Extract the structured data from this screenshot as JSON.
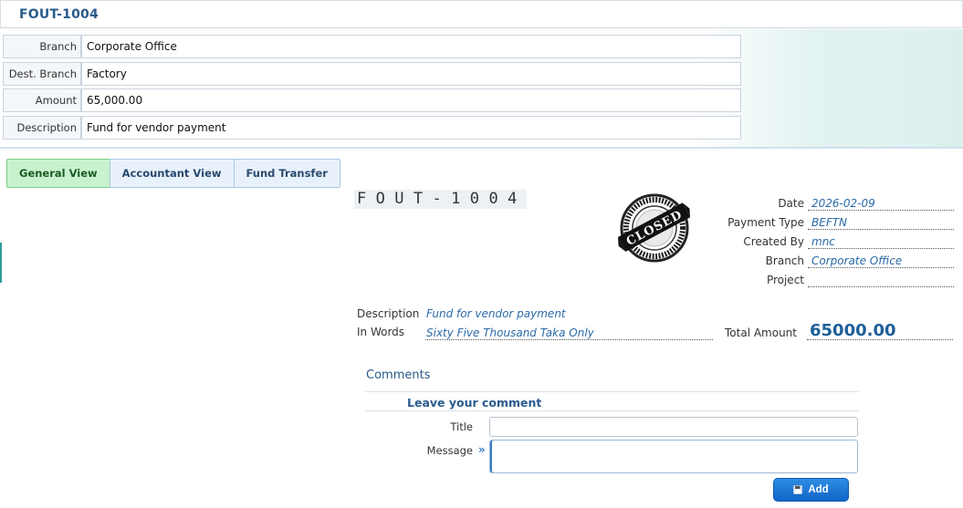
{
  "header": {
    "title": "FOUT-1004"
  },
  "form": {
    "rows": [
      {
        "label": "Branch",
        "value": "Corporate Office"
      },
      {
        "label": "Dest. Branch",
        "value": "Factory"
      },
      {
        "label": "Amount",
        "value": "65,000.00"
      },
      {
        "label": "Description",
        "value": "Fund for vendor payment"
      }
    ]
  },
  "tabs": [
    {
      "label": "General View",
      "active": true
    },
    {
      "label": "Accountant View",
      "active": false
    },
    {
      "label": "Fund Transfer",
      "active": false
    }
  ],
  "voucher": {
    "id": "FOUT-1004",
    "stamp": {
      "text": "CLOSED",
      "icon": "closed-stamp-icon"
    },
    "meta": [
      {
        "label": "Date",
        "value": "2026-02-09"
      },
      {
        "label": "Payment Type",
        "value": "BEFTN"
      },
      {
        "label": "Created By",
        "value": "mnc"
      },
      {
        "label": "Branch",
        "value": "Corporate Office"
      },
      {
        "label": "Project",
        "value": ""
      }
    ],
    "description_label": "Description",
    "description": "Fund for vendor payment",
    "in_words_label": "In Words",
    "in_words": "Sixty Five Thousand Taka Only",
    "total_label": "Total Amount",
    "total": "65000.00"
  },
  "comments": {
    "section_title": "Comments",
    "form_title": "Leave your comment",
    "title_label": "Title",
    "title_value": "",
    "message_label": "Message",
    "message_value": "",
    "message_icon": "double-chevron-right-icon",
    "add_label": "Add",
    "add_icon": "floppy-disk-icon"
  },
  "colors": {
    "accent": "#2a5b8c",
    "value_text": "#2a6aa8",
    "active_tab": "#c8f2cd",
    "button": "#1a73d1"
  }
}
